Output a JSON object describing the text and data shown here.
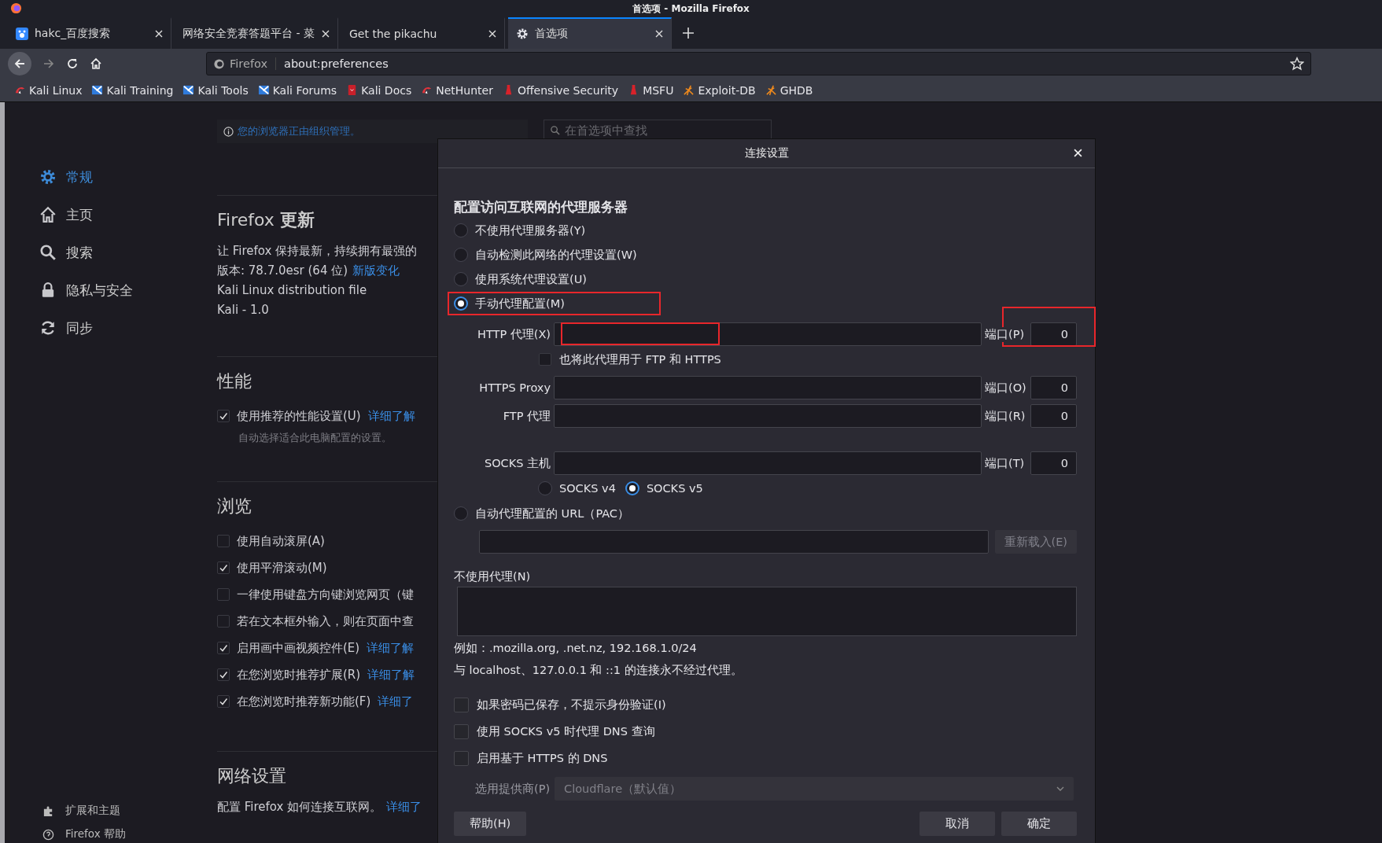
{
  "window": {
    "title": "首选项 - Mozilla Firefox"
  },
  "tabs": [
    {
      "label": "hakc_百度搜索",
      "kind": "paw",
      "selected": false
    },
    {
      "label": "网络安全竞赛答题平台 - 菜",
      "kind": "plain",
      "selected": false
    },
    {
      "label": "Get the pikachu",
      "kind": "plain",
      "selected": false
    },
    {
      "label": "首选项",
      "kind": "gear",
      "selected": true
    }
  ],
  "navbar": {
    "identity": "Firefox",
    "url": "about:preferences"
  },
  "bookmarks": [
    {
      "label": "Kali Linux",
      "kind": "dragon"
    },
    {
      "label": "Kali Training",
      "kind": "bird"
    },
    {
      "label": "Kali Tools",
      "kind": "bird"
    },
    {
      "label": "Kali Forums",
      "kind": "bird"
    },
    {
      "label": "Kali Docs",
      "kind": "book"
    },
    {
      "label": "NetHunter",
      "kind": "dragon"
    },
    {
      "label": "Offensive Security",
      "kind": "bottle"
    },
    {
      "label": "MSFU",
      "kind": "bottle"
    },
    {
      "label": "Exploit-DB",
      "kind": "spider"
    },
    {
      "label": "GHDB",
      "kind": "spider"
    }
  ],
  "sidebar": {
    "items": [
      {
        "label": "常规",
        "kind": "gear",
        "selected": true
      },
      {
        "label": "主页",
        "kind": "home",
        "selected": false
      },
      {
        "label": "搜索",
        "kind": "search",
        "selected": false
      },
      {
        "label": "隐私与安全",
        "kind": "lock",
        "selected": false
      },
      {
        "label": "同步",
        "kind": "sync",
        "selected": false
      }
    ],
    "footer": [
      {
        "label": "扩展和主题",
        "kind": "puzzle",
        "selected": false
      },
      {
        "label": "Firefox 帮助",
        "kind": "help",
        "selected": false
      }
    ]
  },
  "prefs": {
    "notice": "您的浏览器正由组织管理。",
    "search": {
      "placeholder": "在首选项中查找"
    },
    "sections": [
      {
        "title": "Firefox **更新**",
        "items": [
          {
            "kind": "text",
            "text": "让 Firefox 保持最新，持续拥有最强的"
          },
          {
            "kind": "text",
            "text": "版本: 78.7.0esr (64 位)",
            "link": "新版变化"
          },
          {
            "kind": "text",
            "text": "Kali Linux distribution file"
          },
          {
            "kind": "text",
            "text": "Kali - 1.0"
          }
        ]
      },
      {
        "title": "性能",
        "items": [
          {
            "kind": "checkbox",
            "text": "使用推荐的性能设置(U)",
            "checked": true,
            "link": "详细了解"
          },
          {
            "kind": "note",
            "text": "自动选择适合此电脑配置的设置。"
          }
        ]
      },
      {
        "title": "浏览",
        "items": [
          {
            "kind": "checkbox",
            "text": "使用自动滚屏(A)",
            "checked": false
          },
          {
            "kind": "checkbox",
            "text": "使用平滑滚动(M)",
            "checked": true
          },
          {
            "kind": "checkbox",
            "text": "一律使用键盘方向键浏览网页（键",
            "checked": false
          },
          {
            "kind": "checkbox",
            "text": "若在文本框外输入，则在页面中查",
            "checked": false
          },
          {
            "kind": "checkbox",
            "text": "启用画中画视频控件(E)",
            "checked": true,
            "link": "详细了解"
          },
          {
            "kind": "checkbox",
            "text": "在您浏览时推荐扩展(R)",
            "checked": true,
            "link": "详细了解"
          },
          {
            "kind": "checkbox",
            "text": "在您浏览时推荐新功能(F)",
            "checked": true,
            "link": "详细了"
          }
        ]
      },
      {
        "title": "网络设置",
        "items": [
          {
            "kind": "text",
            "text": "配置 Firefox 如何连接互联网。",
            "link": "详细了"
          }
        ]
      }
    ]
  },
  "dialog": {
    "title": "连接设置",
    "heading": "配置访问互联网的代理服务器",
    "modes": [
      {
        "label": "不使用代理服务器(Y)",
        "selected": false,
        "highlighted": false
      },
      {
        "label": "自动检测此网络的代理设置(W)",
        "selected": false,
        "highlighted": false
      },
      {
        "label": "使用系统代理设置(U)",
        "selected": false,
        "highlighted": false
      },
      {
        "label": "手动代理配置(M)",
        "selected": true,
        "highlighted": true
      }
    ],
    "manual": {
      "rows": [
        {
          "label": "HTTP 代理(X)",
          "port_label": "端口(P)",
          "port": "0",
          "field_highlighted": true,
          "port_highlighted": true
        },
        {
          "label": "HTTPS Proxy",
          "port_label": "端口(O)",
          "port": "0",
          "field_highlighted": false,
          "port_highlighted": false
        },
        {
          "label": "FTP 代理",
          "port_label": "端口(R)",
          "port": "0",
          "field_highlighted": false,
          "port_highlighted": false
        },
        {
          "label": "SOCKS 主机",
          "port_label": "端口(T)",
          "port": "0",
          "field_highlighted": false,
          "port_highlighted": false
        }
      ],
      "also_use": {
        "label": "也将此代理用于 FTP 和 HTTPS",
        "checked": false
      },
      "socks_versions": [
        {
          "label": "SOCKS v4",
          "selected": false
        },
        {
          "label": "SOCKS v5",
          "selected": true
        }
      ]
    },
    "pac": {
      "label": "自动代理配置的 URL（PAC）",
      "selected": false,
      "reload_button": "重新载入(E)",
      "disabled": true
    },
    "no_proxy": {
      "label": "不使用代理(N)",
      "example": "例如：.mozilla.org, .net.nz, 192.168.1.0/24",
      "note": "与 localhost、127.0.0.1 和 ::1 的连接永不经过代理。"
    },
    "options": [
      {
        "label": "如果密码已保存，不提示身份验证(I)",
        "checked": false
      },
      {
        "label": "使用 SOCKS v5 时代理 DNS 查询",
        "checked": false
      },
      {
        "label": "启用基于 HTTPS 的 DNS",
        "checked": false
      }
    ],
    "provider": {
      "label": "选用提供商(P)",
      "value": "Cloudflare（默认值）",
      "disabled": true
    },
    "buttons": {
      "help": "帮助(H)",
      "cancel": "取消",
      "ok": "确定"
    }
  }
}
